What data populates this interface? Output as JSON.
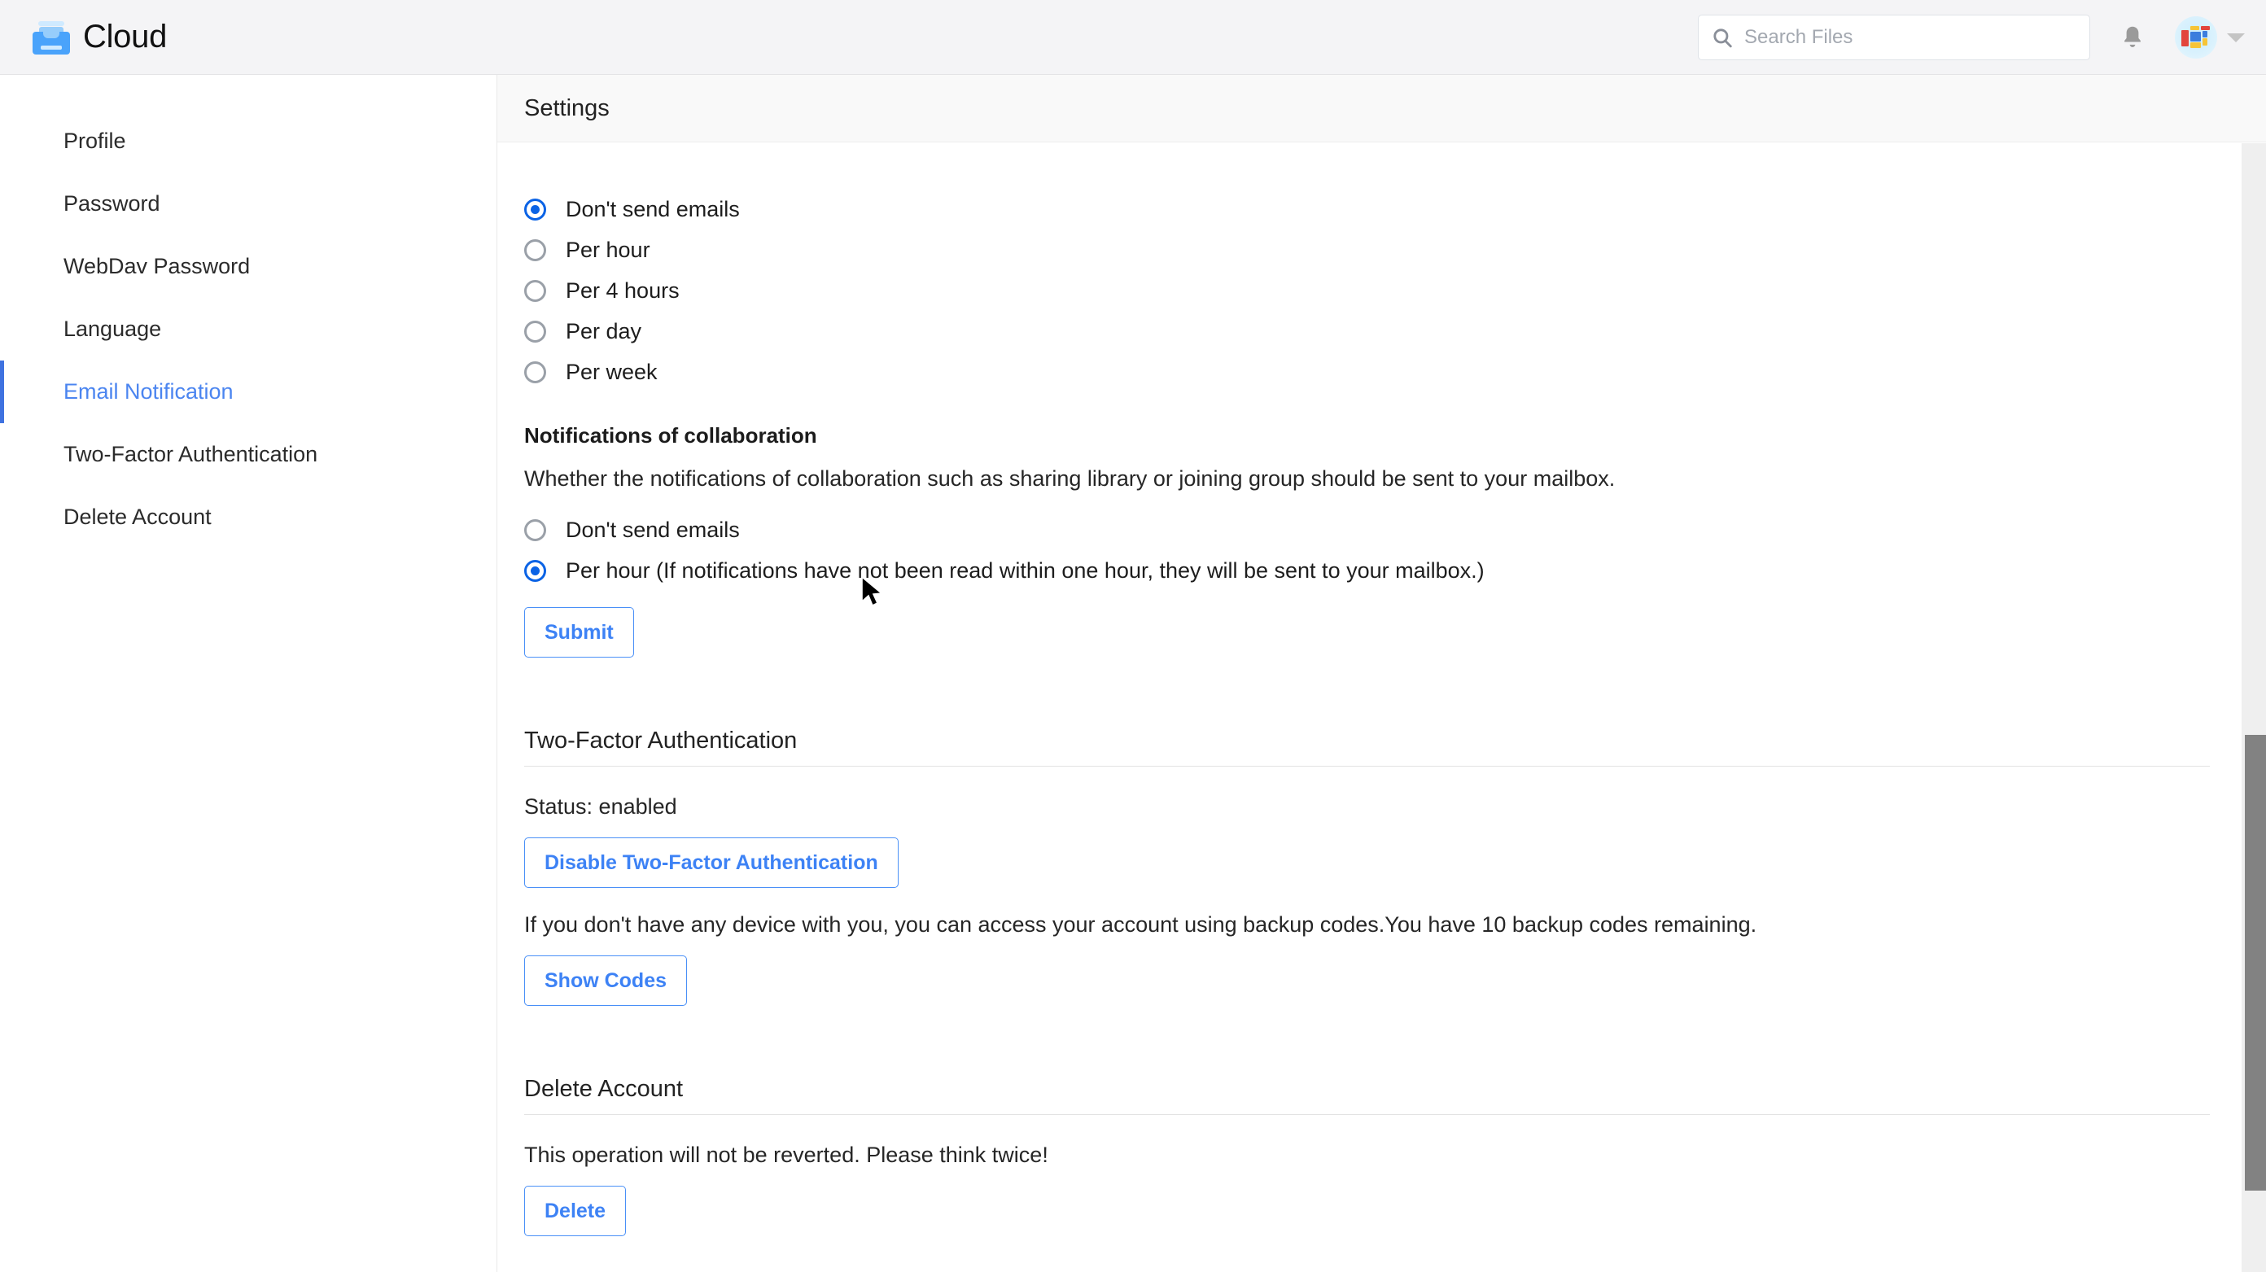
{
  "app": {
    "brand_name": "Cloud",
    "accent_color": "#3d82f5",
    "active_color": "#4b85f0"
  },
  "header": {
    "search": {
      "placeholder": "Search Files",
      "value": "",
      "icon": "search-icon"
    },
    "notifications_icon": "bell-icon",
    "avatar_caret_icon": "chevron-down-icon"
  },
  "sidebar": {
    "items": [
      {
        "label": "Profile",
        "active": false
      },
      {
        "label": "Password",
        "active": false
      },
      {
        "label": "WebDav Password",
        "active": false
      },
      {
        "label": "Language",
        "active": false
      },
      {
        "label": "Email Notification",
        "active": true
      },
      {
        "label": "Two-Factor Authentication",
        "active": false
      },
      {
        "label": "Delete Account",
        "active": false
      }
    ]
  },
  "main": {
    "section_header_title": "Settings",
    "email_notification": {
      "frequency_options": [
        {
          "label": "Don't send emails",
          "selected": true
        },
        {
          "label": "Per hour",
          "selected": false
        },
        {
          "label": "Per 4 hours",
          "selected": false
        },
        {
          "label": "Per day",
          "selected": false
        },
        {
          "label": "Per week",
          "selected": false
        }
      ],
      "collaboration": {
        "heading": "Notifications of collaboration",
        "description": "Whether the notifications of collaboration such as sharing library or joining group should be sent to your mailbox.",
        "options": [
          {
            "label": "Don't send emails",
            "selected": false
          },
          {
            "label": "Per hour (If notifications have not been read within one hour, they will be sent to your mailbox.)",
            "selected": true
          }
        ],
        "submit_label": "Submit"
      }
    },
    "two_factor": {
      "title": "Two-Factor Authentication",
      "status_text": "Status: enabled",
      "disable_button_label": "Disable Two-Factor Authentication",
      "backup_codes_text": "If you don't have any device with you, you can access your account using backup codes.You have 10 backup codes remaining.",
      "show_codes_label": "Show Codes"
    },
    "delete_account": {
      "title": "Delete Account",
      "warning_text": "This operation will not be reverted. Please think twice!",
      "delete_button_label": "Delete"
    }
  }
}
